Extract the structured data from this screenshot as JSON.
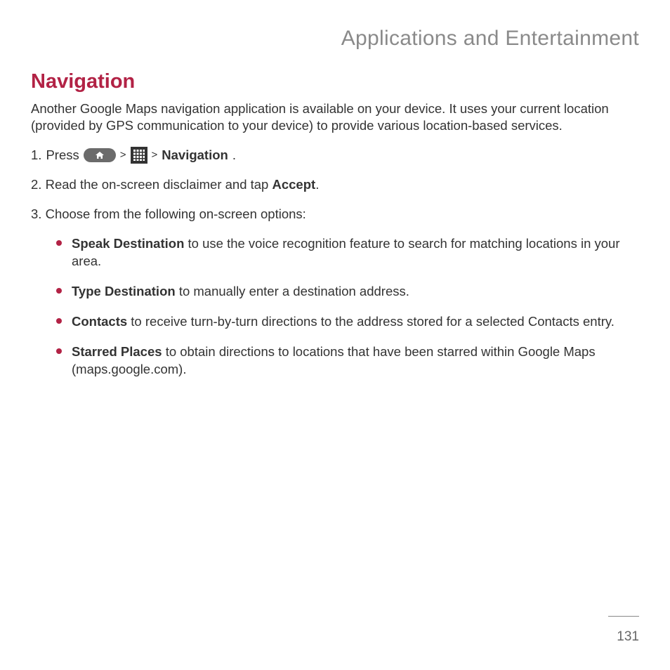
{
  "header": {
    "section_title": "Applications and Entertainment"
  },
  "title": "Navigation",
  "intro": "Another Google Maps navigation application is available on your device. It uses your current location (provided by GPS communication to your device) to provide various location-based services.",
  "steps": {
    "s1": {
      "num": "1.",
      "press": "Press",
      "gt1": ">",
      "gt2": ">",
      "nav_bold": "Navigation",
      "period": "."
    },
    "s2": {
      "num": "2.",
      "pre": "Read the on-screen disclaimer and tap ",
      "accept_bold": "Accept",
      "post": "."
    },
    "s3": {
      "num": "3.",
      "text": "Choose from the following on-screen options:"
    }
  },
  "bullets": {
    "b1": {
      "bold": "Speak Destination",
      "rest": " to use the voice recognition feature to search for matching locations in your area."
    },
    "b2": {
      "bold": "Type Destination",
      "rest": " to manually enter a destination address."
    },
    "b3": {
      "bold": "Contacts",
      "rest": " to receive turn-by-turn directions to the address stored for a selected Contacts entry."
    },
    "b4": {
      "bold": "Starred Places",
      "rest": " to obtain directions to locations that have been starred within Google Maps (maps.google.com)."
    }
  },
  "page_number": "131"
}
